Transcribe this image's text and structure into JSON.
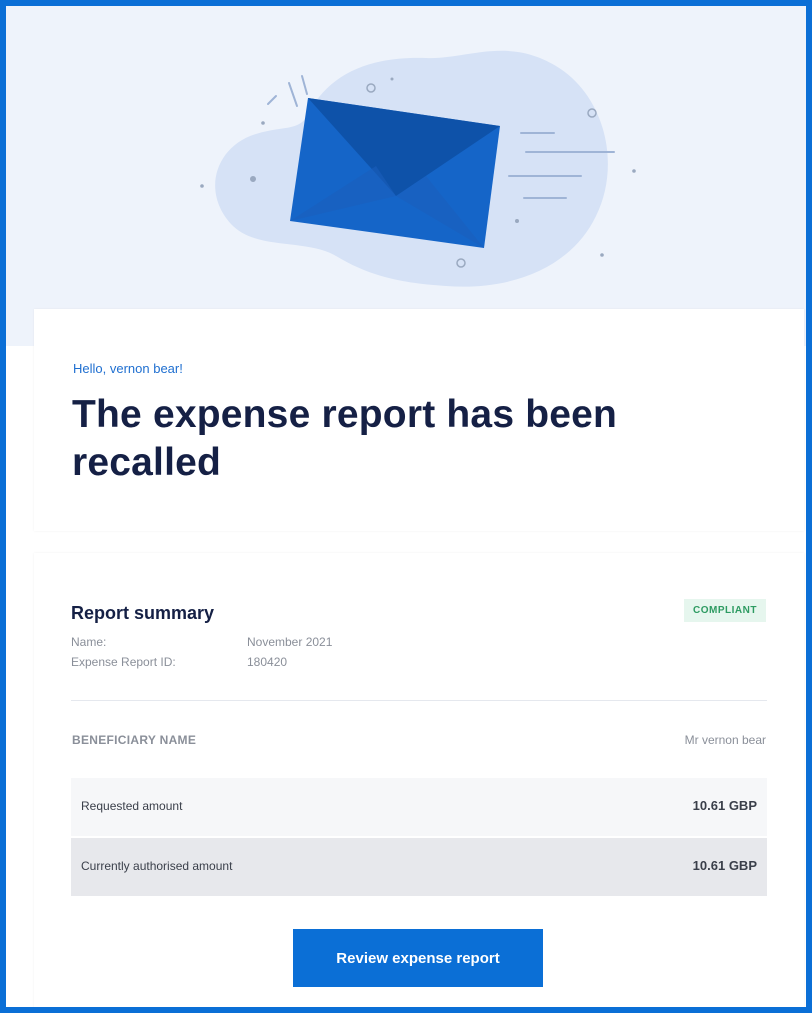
{
  "colors": {
    "frame": "#0b6fd6",
    "hero_bg": "#eef3fb",
    "blob": "#d6e2f6",
    "envelope": "#1565c8",
    "envelope_dark": "#0d4fa3",
    "title": "#152045",
    "greeting": "#1f6fd0",
    "badge_bg": "#e6f6ee",
    "badge_text": "#2e9b62",
    "button": "#0b6fd6"
  },
  "hero": {
    "illustration": "envelope-icon"
  },
  "greeting": "Hello, vernon bear!",
  "title": "The expense report has been recalled",
  "summary": {
    "title": "Report summary",
    "status_badge": "COMPLIANT",
    "meta": [
      {
        "label": "Name:",
        "value": "November 2021"
      },
      {
        "label": "Expense Report ID:",
        "value": "180420"
      }
    ],
    "beneficiary_label": "BENEFICIARY NAME",
    "beneficiary_value": "Mr vernon bear",
    "rows": [
      {
        "label": "Requested amount",
        "value": "10.61 GBP"
      },
      {
        "label": "Currently authorised amount",
        "value": "10.61 GBP"
      }
    ]
  },
  "button": {
    "label": "Review expense report"
  }
}
